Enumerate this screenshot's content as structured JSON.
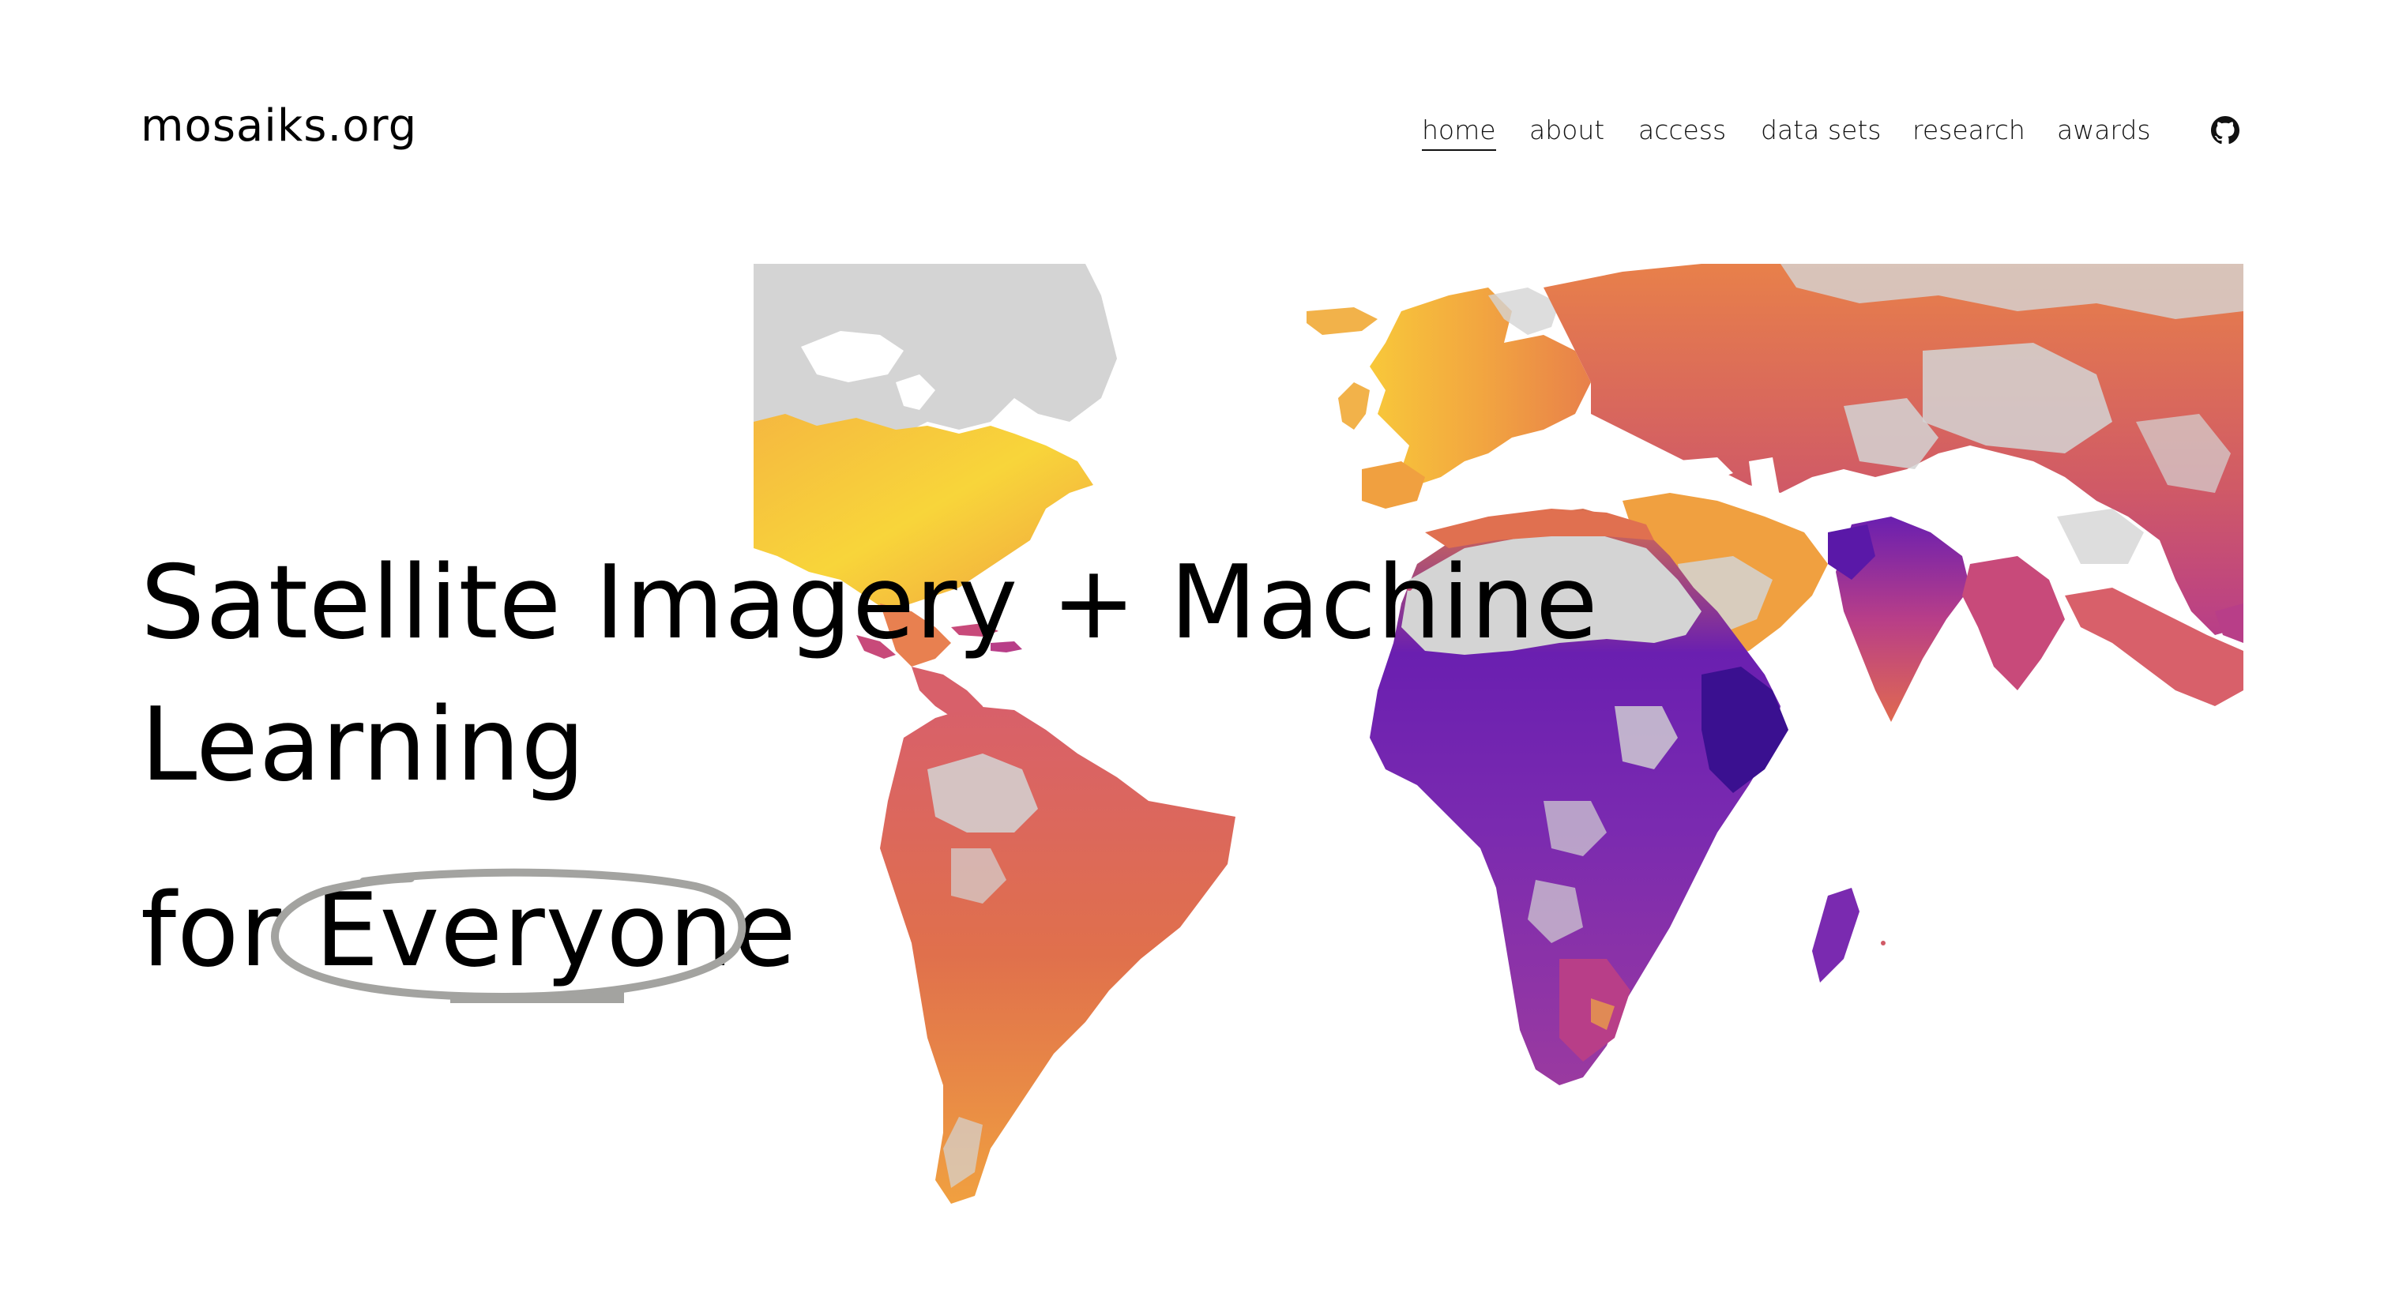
{
  "header": {
    "site_title": "mosaiks.org",
    "nav": [
      {
        "label": "home",
        "active": true
      },
      {
        "label": "about",
        "active": false
      },
      {
        "label": "access",
        "active": false
      },
      {
        "label": "data sets",
        "active": false
      },
      {
        "label": "research",
        "active": false
      },
      {
        "label": "awards",
        "active": false
      }
    ],
    "github_icon": "github-icon"
  },
  "hero": {
    "line1": "Satellite Imagery + Machine",
    "line2": "Learning",
    "line3_prefix": "for ",
    "line3_highlight": "Everyone"
  },
  "map": {
    "colors": {
      "no_data": "#d4d4d4",
      "yellow": "#f8d53a",
      "orange": "#f08c3c",
      "magenta": "#c84a7a",
      "purple": "#6a1fb0",
      "deep_purple": "#3a1090"
    }
  },
  "colors": {
    "text": "#000000",
    "background": "#ffffff",
    "circle": "#a3a3a0"
  }
}
